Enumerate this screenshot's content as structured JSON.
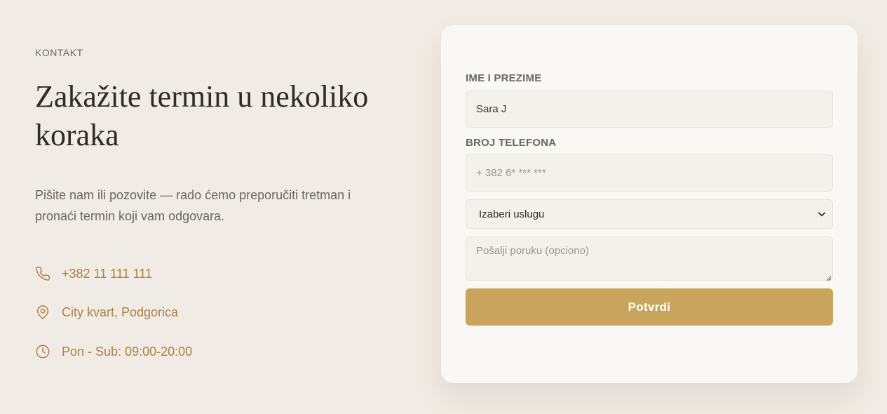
{
  "section": {
    "eyebrow": "KONTAKT",
    "headline": "Zakažite termin u nekoliko koraka",
    "intro": "Pišite nam ili pozovite — rado ćemo preporučiti tretman i pronaći termin koji vam odgovara."
  },
  "contact": {
    "phone": {
      "icon": "phone-icon",
      "text": "+382 11 111 111"
    },
    "location": {
      "icon": "map-pin-icon",
      "text": "City kvart, Podgorica"
    },
    "hours": {
      "icon": "clock-icon",
      "text": "Pon - Sub: 09:00-20:00"
    }
  },
  "form": {
    "name_label": "IME I PREZIME",
    "name_value": "Sara J",
    "phone_label": "BROJ TELEFONA",
    "phone_placeholder": "+ 382 6* *** ***",
    "service_selected": "Izaberi uslugu",
    "message_placeholder": "Pošalji poruku (opciono)",
    "submit_label": "Potvrdi"
  },
  "colors": {
    "background": "#f0ebe4",
    "card": "#faf8f4",
    "accent": "#c8a45c",
    "accent_text": "#a88441"
  }
}
